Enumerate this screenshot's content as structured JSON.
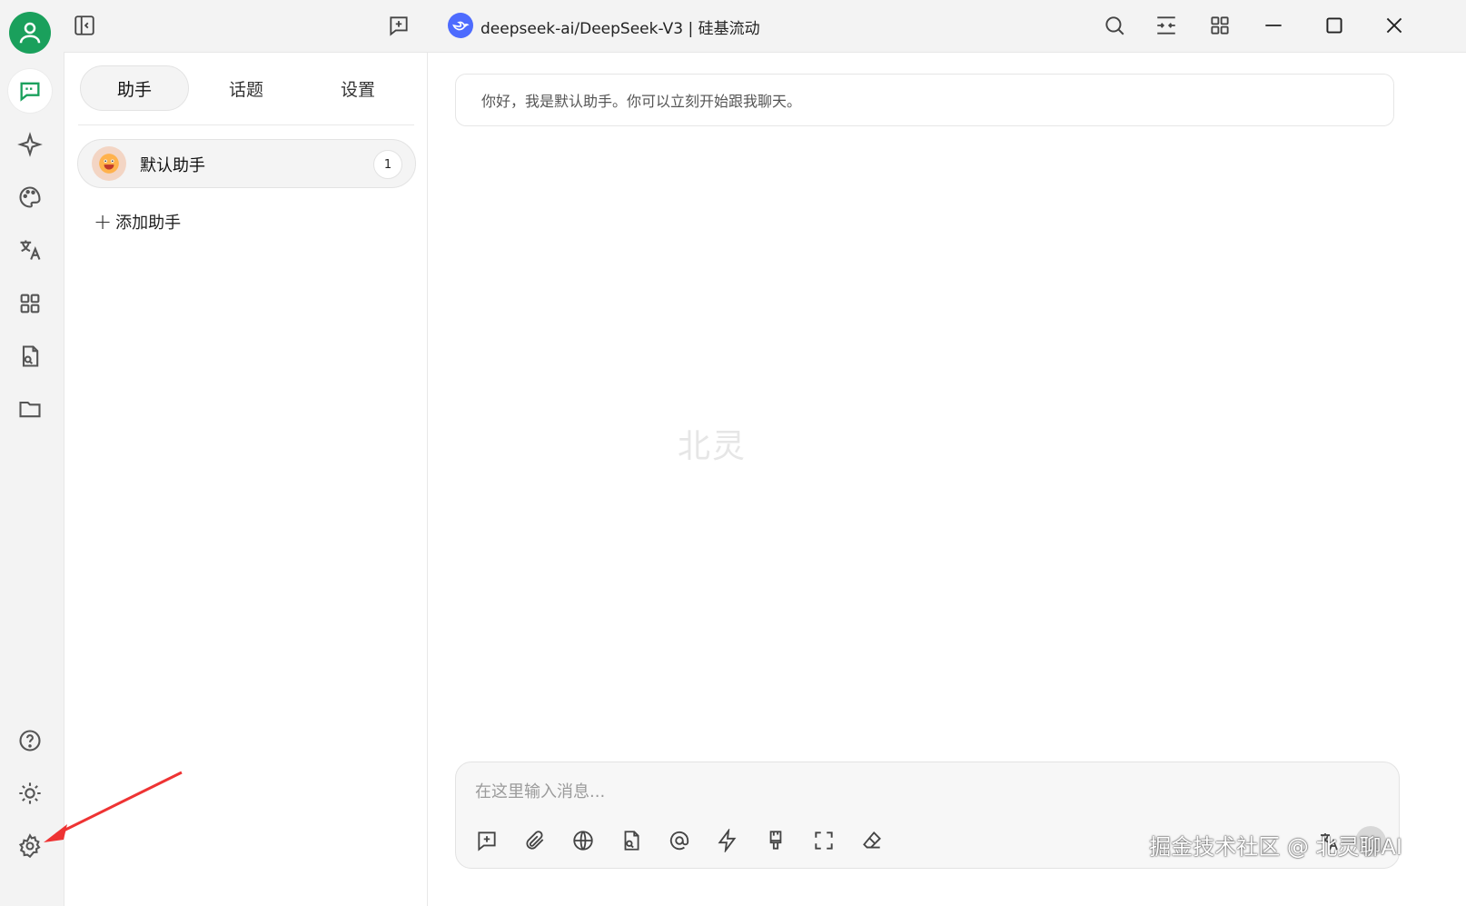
{
  "titlebar": {
    "model_title": "deepseek-ai/DeepSeek-V3 | 硅基流动"
  },
  "assistant_panel": {
    "tabs": [
      {
        "label": "助手",
        "active": true
      },
      {
        "label": "话题",
        "active": false
      },
      {
        "label": "设置",
        "active": false
      }
    ],
    "assistants": [
      {
        "name": "默认助手",
        "count": "1",
        "emoji": "grinning-face-icon"
      }
    ],
    "add_label": "添加助手"
  },
  "chat": {
    "greeting": "你好，我是默认助手。你可以立刻开始跟我聊天。",
    "center_watermark": "北灵",
    "input_placeholder": "在这里输入消息..."
  },
  "overlay": {
    "site_watermark": "掘金技术社区 @ 北灵聊AI"
  },
  "colors": {
    "brand_green": "#1aa05c",
    "deepseek_blue": "#4d6bfe",
    "annotation_red": "#ee3333"
  },
  "icons": {
    "rail": [
      "user-avatar-icon",
      "chat-icon",
      "sparkle-icon",
      "palette-icon",
      "translate-icon",
      "apps-grid-icon",
      "file-search-icon",
      "folder-icon",
      "help-icon",
      "theme-sun-icon",
      "settings-gear-icon"
    ],
    "titlebar": [
      "sidebar-toggle-icon",
      "new-chat-icon",
      "search-icon",
      "expand-width-icon",
      "layout-grid-icon",
      "minimize-icon",
      "maximize-icon",
      "close-icon"
    ],
    "composer": [
      "new-topic-icon",
      "attach-icon",
      "web-search-icon",
      "knowledge-file-icon",
      "mention-icon",
      "quick-phrase-icon",
      "clear-style-icon",
      "fullscreen-icon",
      "eraser-icon",
      "translate-icon",
      "send-icon"
    ]
  }
}
